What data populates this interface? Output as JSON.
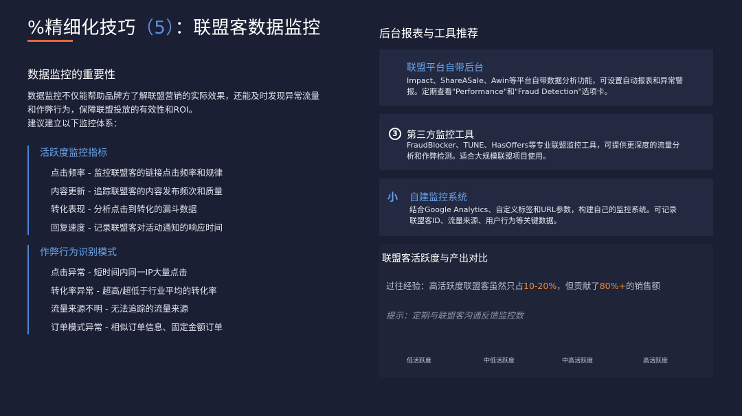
{
  "title": {
    "prefix": "%精细化技巧",
    "number": "（5）",
    "suffix": "：联盟客数据监控"
  },
  "left": {
    "heading": "数据监控的重要性",
    "intro": [
      "数据监控不仅能帮助品牌方了解联盟营销的实际效果，还能及时发现异常流量",
      "和作弊行为，保障联盟投放的有效性和ROI。",
      "建议建立以下监控体系："
    ],
    "groups": [
      {
        "title": "活跃度监控指标",
        "items": [
          "点击频率 - 监控联盟客的链接点击频率和规律",
          "内容更新 - 追踪联盟客的内容发布频次和质量",
          "转化表现 - 分析点击到转化的漏斗数据",
          "回复速度 - 记录联盟客对活动通知的响应时间"
        ]
      },
      {
        "title": "作弊行为识别模式",
        "items": [
          "点击异常 - 短时间内同一IP大量点击",
          "转化率异常 - 超高/超低于行业平均的转化率",
          "流量来源不明 - 无法追踪的流量来源",
          "订单模式异常 - 相似订单信息、固定金额订单"
        ]
      }
    ]
  },
  "right": {
    "heading": "后台报表与工具推荐",
    "cards": [
      {
        "title": "联盟平台自带后台",
        "body": [
          "Impact、ShareASale、Awin等平台自带数据分析功能，可设置自动报表和异常警",
          "报。定期查看\"Performance\"和\"Fraud Detection\"选项卡。"
        ]
      },
      {
        "badge": "3",
        "title": "第三方监控工具",
        "body": [
          "FraudBlocker、TUNE、HasOffers等专业联盟监控工具，可提供更深度的流量分",
          "析和作弊检测。适合大规模联盟项目使用。"
        ]
      },
      {
        "badge": "小",
        "title": "自建监控系统",
        "body": [
          "结合Google Analytics、自定义标签和URL参数，构建自己的监控系统。可记录",
          "联盟客ID、流量来源、用户行为等关键数据。"
        ]
      }
    ],
    "comparison": {
      "title": "联盟客活跃度与产出对比",
      "exp_pre": "过往经验：高活跃度联盟客虽然只占",
      "exp_hl1": "10-20%",
      "exp_mid": "，但贡献了",
      "exp_hl2": "80%+",
      "exp_post": "的销售额",
      "tip": "提示：定期与联盟客沟通反馈监控数",
      "axis": [
        "低活跃度",
        "中低活跃度",
        "中高活跃度",
        "高活跃度"
      ]
    }
  },
  "colors": {
    "background": "#1b1f33",
    "accent_blue": "#6aa3ec",
    "accent_orange": "#f08a3a",
    "underline": "#e8673a"
  }
}
